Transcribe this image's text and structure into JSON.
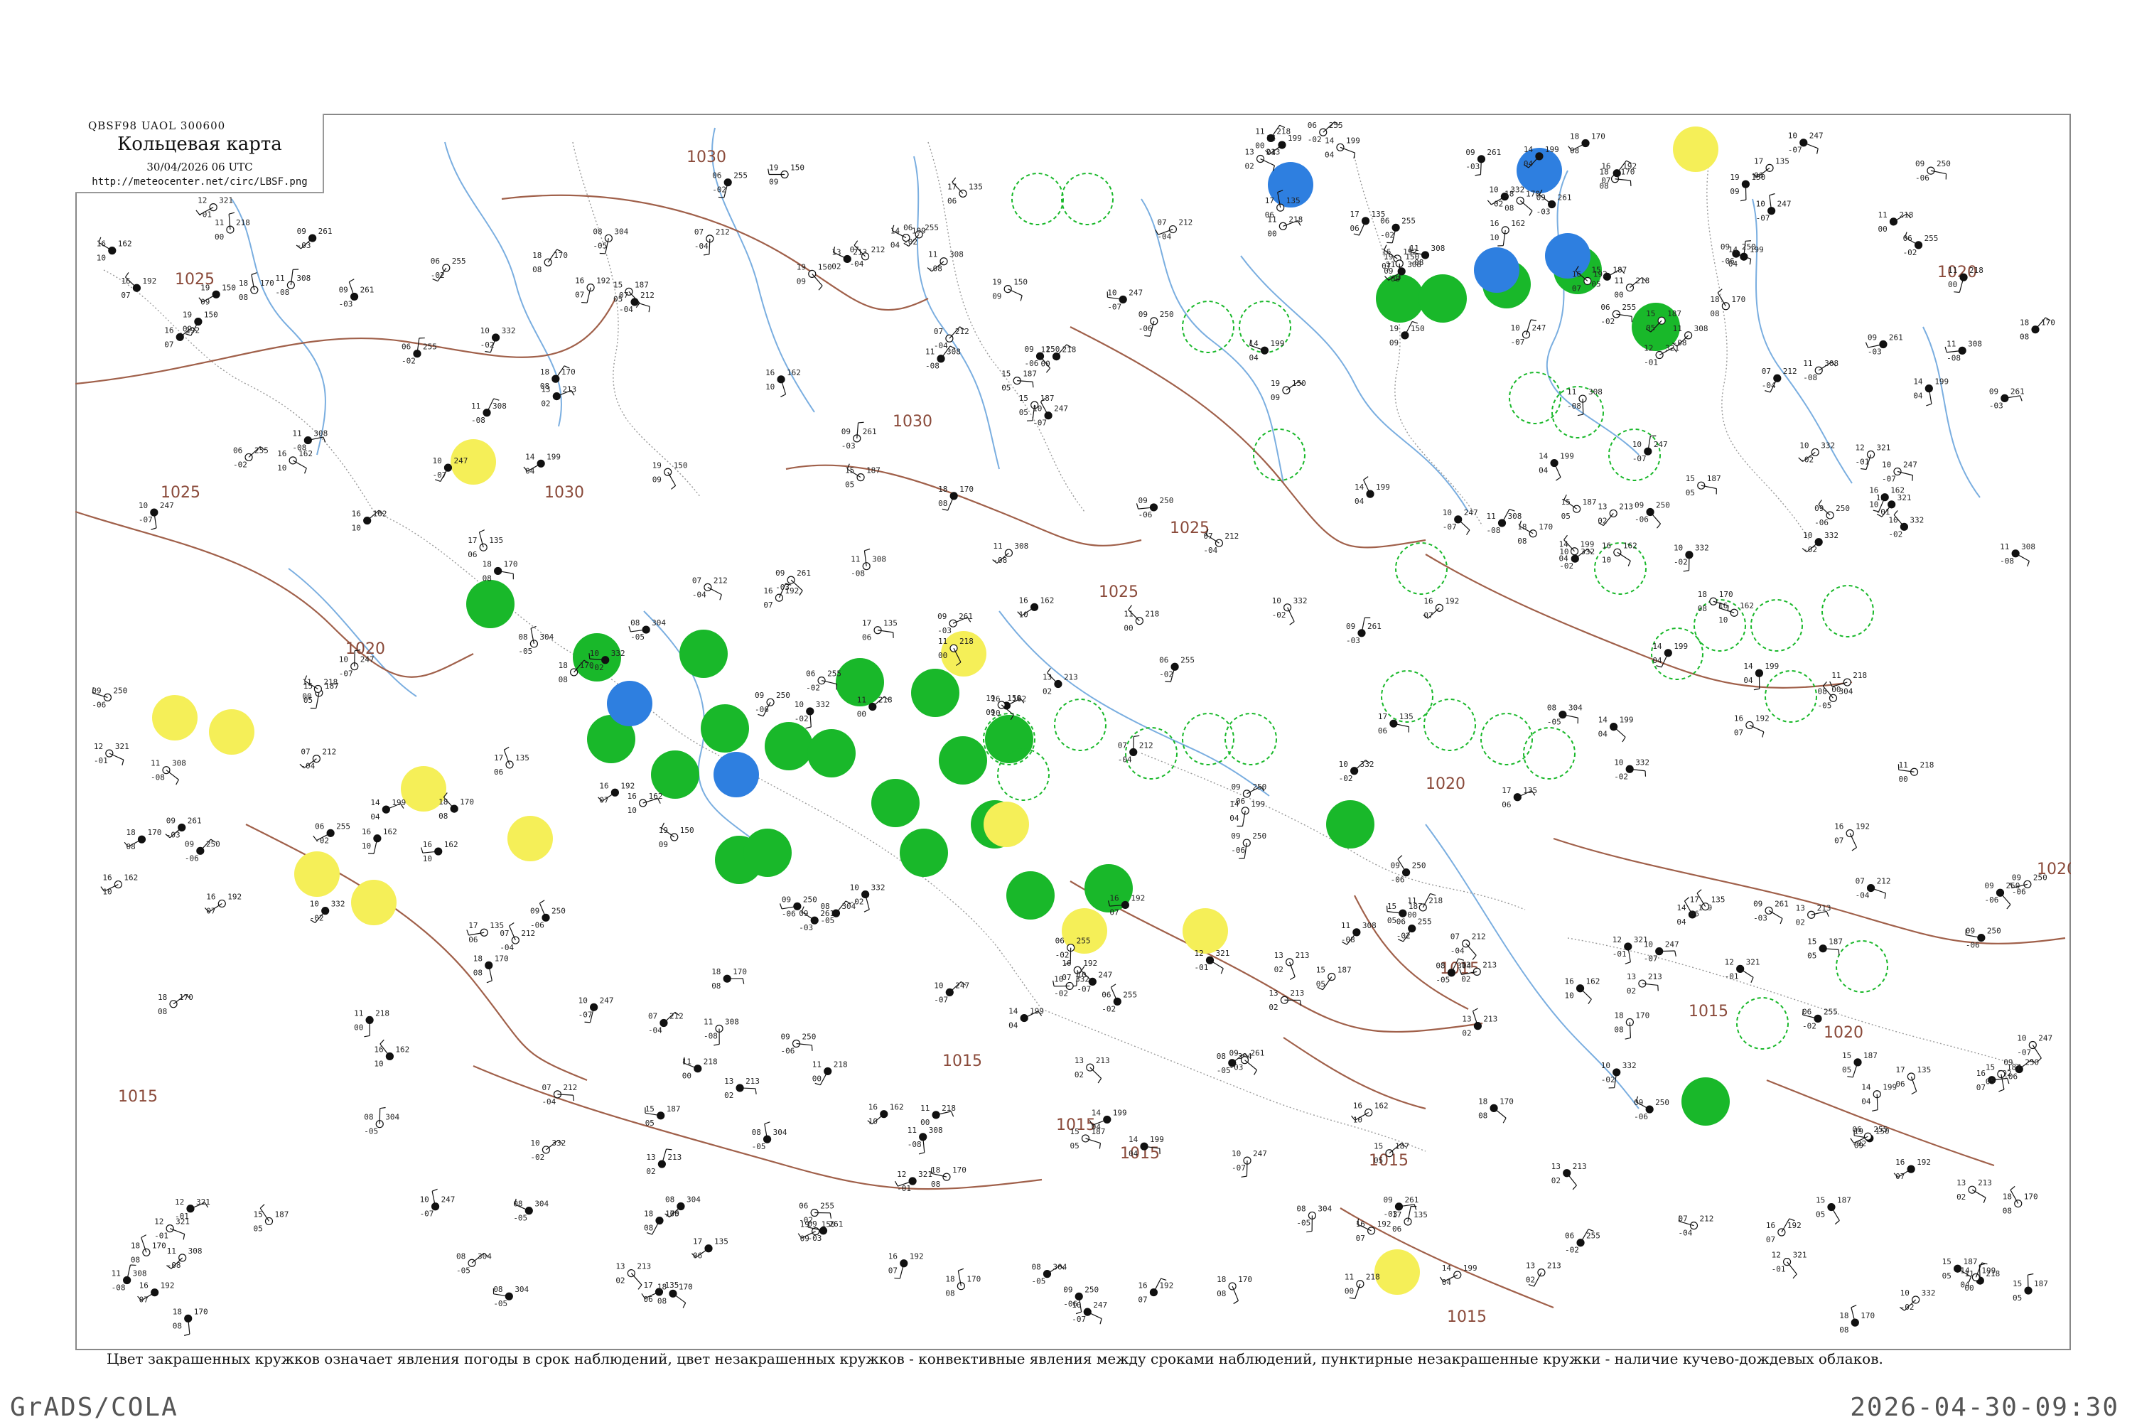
{
  "title": {
    "code": "QBSF98  UAOL  300600",
    "main": "Кольцевая карта",
    "date": "30/04/2026 06 UTC",
    "url": "http://meteocenter.net/circ/LBSF.png"
  },
  "footnote": "Цвет закрашенных кружков означает явления погоды в срок наблюдений, цвет незакрашенных кружков - конвективные явления между сроками наблюдений, пунктирные незакрашенные кружки - наличие кучево-дождевых облаков.",
  "footer": {
    "left": "GrADS/COLA",
    "right": "2026-04-30-09:30"
  },
  "colors": {
    "isobar": "#a0604a",
    "river": "#7aaee0",
    "border": "#999999",
    "rain": "#19b82a",
    "fog": "#f5ef58",
    "snow": "#2e7fe0",
    "cb": "#19b82a",
    "station": "#111111"
  },
  "isobar_labels": [
    "1025",
    "1025",
    "1030",
    "1030",
    "1030",
    "1025",
    "1020",
    "1025",
    "1020",
    "1020",
    "1020",
    "1015",
    "1015",
    "1015",
    "1015",
    "1015",
    "1015",
    "1015",
    "1015",
    "1020"
  ],
  "station_samples": [
    {
      "p": "332",
      "t": "10",
      "d": "-02"
    },
    {
      "p": "321",
      "t": "12",
      "d": "-01"
    },
    {
      "p": "308",
      "t": "11",
      "d": "-08"
    },
    {
      "p": "304",
      "t": "08",
      "d": "-05"
    },
    {
      "p": "261",
      "t": "09",
      "d": "-03"
    },
    {
      "p": "247",
      "t": "10",
      "d": "-07"
    },
    {
      "p": "213",
      "t": "13",
      "d": "02"
    },
    {
      "p": "212",
      "t": "07",
      "d": "-04"
    },
    {
      "p": "250",
      "t": "09",
      "d": "-06"
    },
    {
      "p": "255",
      "t": "06",
      "d": "-02"
    },
    {
      "p": "218",
      "t": "11",
      "d": "00"
    },
    {
      "p": "199",
      "t": "14",
      "d": "04"
    },
    {
      "p": "192",
      "t": "16",
      "d": "07"
    },
    {
      "p": "187",
      "t": "15",
      "d": "05"
    },
    {
      "p": "170",
      "t": "18",
      "d": "08"
    },
    {
      "p": "150",
      "t": "19",
      "d": "09"
    },
    {
      "p": "135",
      "t": "17",
      "d": "06"
    },
    {
      "p": "162",
      "t": "16",
      "d": "10"
    }
  ],
  "weather_circles": [
    {
      "kind": "rain",
      "fill": true
    },
    {
      "kind": "fog",
      "fill": true
    },
    {
      "kind": "snow",
      "fill": true
    },
    {
      "kind": "cb",
      "fill": false
    }
  ]
}
